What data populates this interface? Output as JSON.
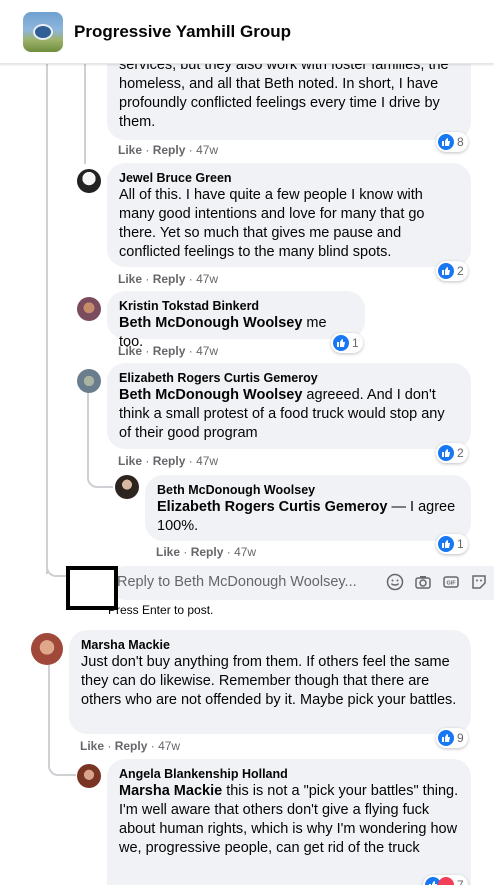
{
  "header": {
    "group_name": "Progressive Yamhill Group"
  },
  "actions": {
    "like": "Like",
    "reply": "Reply",
    "sep": "·"
  },
  "comments": [
    {
      "id": "c0",
      "text": "services, but they also work with foster families, the homeless, and all that Beth noted. In short, I have profoundly conflicted feelings every time I drive by them.",
      "age": "47w",
      "reactions": "8"
    },
    {
      "id": "c1",
      "author": "Jewel Bruce Green",
      "text": "All of this. I have quite a few people I know with many good intentions and love for many that go there. Yet so much that gives me pause and conflicted feelings to the many blind spots.",
      "age": "47w",
      "reactions": "2"
    },
    {
      "id": "c2",
      "author": "Kristin Tokstad Binkerd",
      "mention": "Beth McDonough Woolsey",
      "text": " me too.",
      "age": "47w",
      "reactions": "1"
    },
    {
      "id": "c3",
      "author": "Elizabeth Rogers Curtis Gemeroy",
      "mention": "Beth McDonough Woolsey",
      "text": " agreeed. And I don't think a small protest of a food truck would stop any of their good program",
      "age": "47w",
      "reactions": "2"
    },
    {
      "id": "c4",
      "author": "Beth McDonough Woolsey",
      "mention": "Elizabeth Rogers Curtis Gemeroy",
      "text": " — I agree 100%.",
      "age": "47w",
      "reactions": "1"
    },
    {
      "id": "c5",
      "author": "Marsha Mackie",
      "text": "Just don't buy anything from them. If others feel the same they can do likewise. Remember though that there are others who are not offended by it. Maybe pick your battles.",
      "age": "47w",
      "reactions": "9"
    },
    {
      "id": "c6",
      "author": "Angela Blankenship Holland",
      "mention": "Marsha Mackie",
      "text": " this is not a \"pick your battles\" thing. I'm well aware that others don't give a flying fuck about human rights, which is why I'm wondering how we, progressive people, can get rid of the truck",
      "reactions": "7"
    }
  ],
  "reply_box": {
    "placeholder": "Reply to Beth McDonough Woolsey...",
    "hint": "Press Enter to post."
  },
  "icons": [
    "smiley-icon",
    "camera-icon",
    "gif-icon",
    "sticker-icon",
    "like-reaction-icon",
    "love-reaction-icon"
  ],
  "colors": {
    "accent": "#1877f2",
    "bubble": "#f0f2f5",
    "muted": "#65676b",
    "love": "#f33e58"
  }
}
